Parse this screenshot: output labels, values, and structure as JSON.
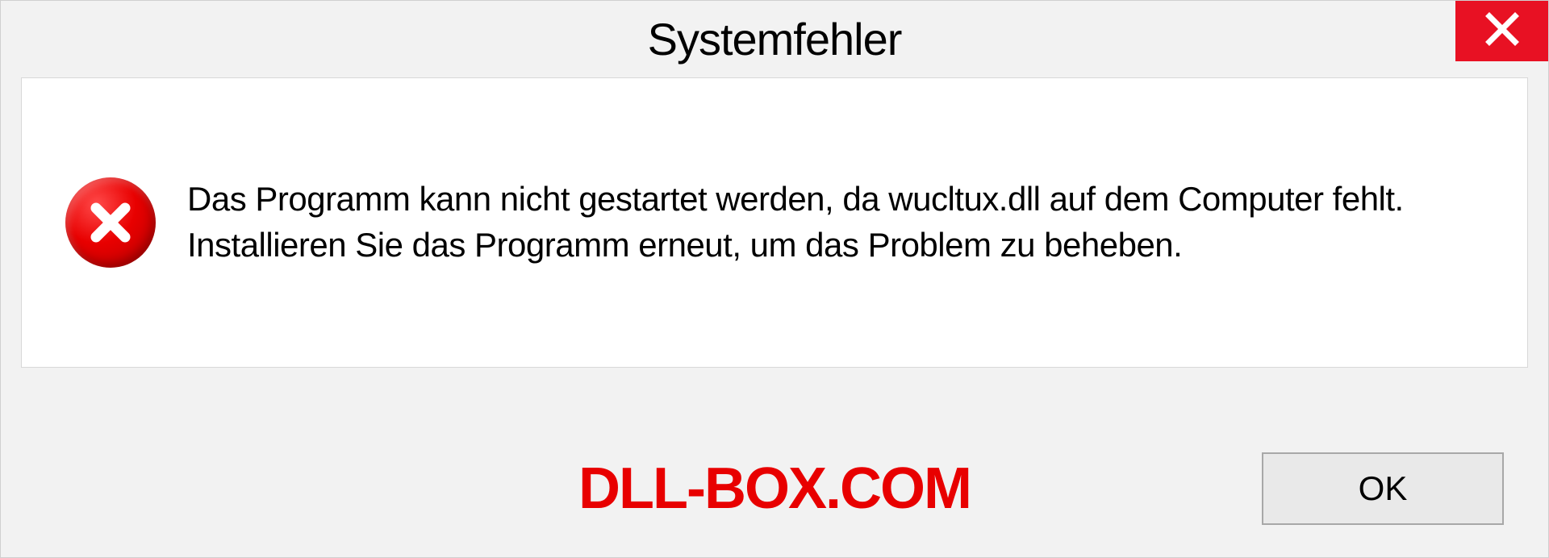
{
  "dialog": {
    "title": "Systemfehler",
    "message": "Das Programm kann nicht gestartet werden, da wucltux.dll auf dem Computer fehlt. Installieren Sie das Programm erneut, um das Problem zu beheben.",
    "ok_label": "OK"
  },
  "watermark": "DLL-BOX.COM"
}
